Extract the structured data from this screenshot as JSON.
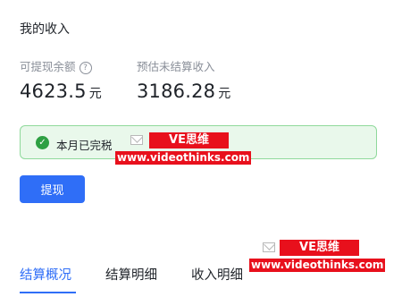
{
  "page": {
    "title": "我的收入"
  },
  "stats": {
    "withdrawable": {
      "label": "可提现余额",
      "amount": "4623.5",
      "unit": "元",
      "help_icon": "question-circle-icon"
    },
    "pending": {
      "label": "预估未结算收入",
      "amount": "3186.28",
      "unit": "元"
    }
  },
  "notice": {
    "text": "本月已完税",
    "icon": "check-circle-icon"
  },
  "actions": {
    "withdraw_label": "提现"
  },
  "tabs": [
    {
      "label": "结算概况",
      "active": true
    },
    {
      "label": "结算明细",
      "active": false
    },
    {
      "label": "收入明细",
      "active": false
    }
  ],
  "watermarks": [
    {
      "title": "VE思维",
      "url": "www.videothinks.com"
    },
    {
      "title": "VE思维",
      "url": "www.videothinks.com"
    }
  ],
  "colors": {
    "accent": "#2f6ef7",
    "success": "#2ea043",
    "notice_bg": "#e9f8eb",
    "notice_border": "#8fd99b",
    "watermark": "#e8101c"
  }
}
